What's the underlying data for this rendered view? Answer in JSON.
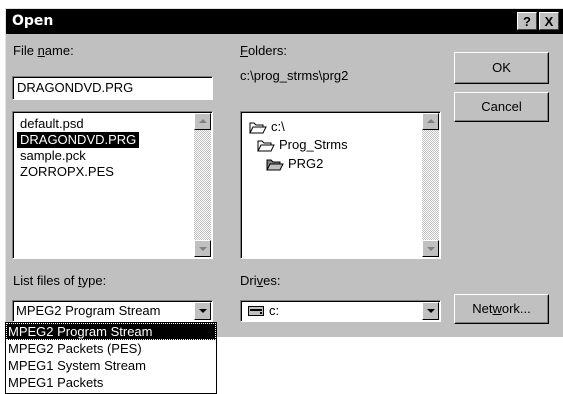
{
  "window": {
    "title": "Open"
  },
  "titlebar_buttons": {
    "help": "?",
    "close": "X"
  },
  "file_name": {
    "label_pre": "File ",
    "label_accel": "n",
    "label_post": "ame:",
    "value": "DRAGONDVD.PRG"
  },
  "files": [
    {
      "name": "default.psd",
      "selected": false
    },
    {
      "name": "DRAGONDVD.PRG",
      "selected": true
    },
    {
      "name": "sample.pck",
      "selected": false
    },
    {
      "name": "ZORROPX.PES",
      "selected": false
    }
  ],
  "folders": {
    "label_accel": "F",
    "label_post": "olders:",
    "current_path": "c:\\prog_strms\\prg2",
    "tree": [
      {
        "name": "c:\\",
        "icon": "open-folder-icon"
      },
      {
        "name": "Prog_Strms",
        "icon": "open-folder-icon"
      },
      {
        "name": "PRG2",
        "icon": "open-folder-icon"
      }
    ]
  },
  "buttons": {
    "ok": "OK",
    "cancel": "Cancel",
    "network_pre": "Net",
    "network_accel": "w",
    "network_post": "ork..."
  },
  "file_type": {
    "label_pre": "List files of ",
    "label_accel": "t",
    "label_post": "ype:",
    "selected": "MPEG2 Program Stream",
    "options": [
      "MPEG2 Program Stream",
      "MPEG2 Packets (PES)",
      "MPEG1 System Stream",
      "MPEG1 Packets"
    ]
  },
  "drives": {
    "label_pre": "Dri",
    "label_accel": "v",
    "label_post": "es:",
    "selected": "c:",
    "icon": "hard-drive-icon"
  }
}
